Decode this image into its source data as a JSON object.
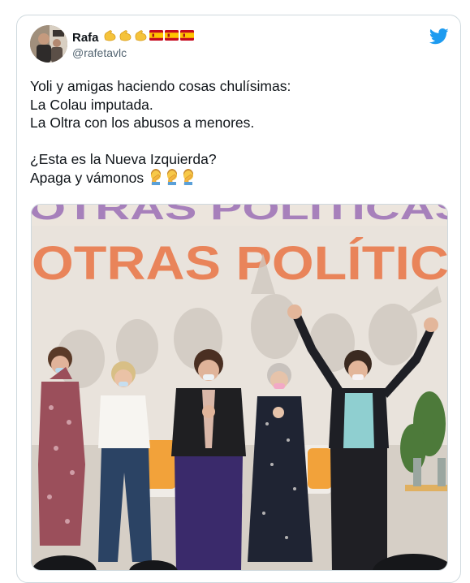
{
  "user": {
    "display_name": "Rafa",
    "handle": "@rafetavlc",
    "name_emojis": [
      "flexed-biceps",
      "flexed-biceps",
      "flexed-biceps",
      "flag-spain",
      "flag-spain",
      "flag-spain"
    ]
  },
  "tweet": {
    "lines": [
      "Yoli y amigas haciendo cosas chulísimas:",
      "La Colau imputada.",
      "La Oltra con los abusos a menores.",
      "",
      "¿Esta es la Nueva Izquierda?",
      "Apaga y vámonos"
    ],
    "trailing_emojis": [
      "facepalm",
      "facepalm",
      "facepalm"
    ]
  },
  "media": {
    "banner_top": "OTRAS POLÍTICAS",
    "banner_main": "OTRAS POLÍTIC"
  },
  "colors": {
    "twitter_blue": "#1d9bf0",
    "banner_text": "#e9845a",
    "banner_purple": "#9b6fb6",
    "handle_gray": "#536471"
  },
  "icons": {
    "platform": "twitter-bird-icon"
  }
}
